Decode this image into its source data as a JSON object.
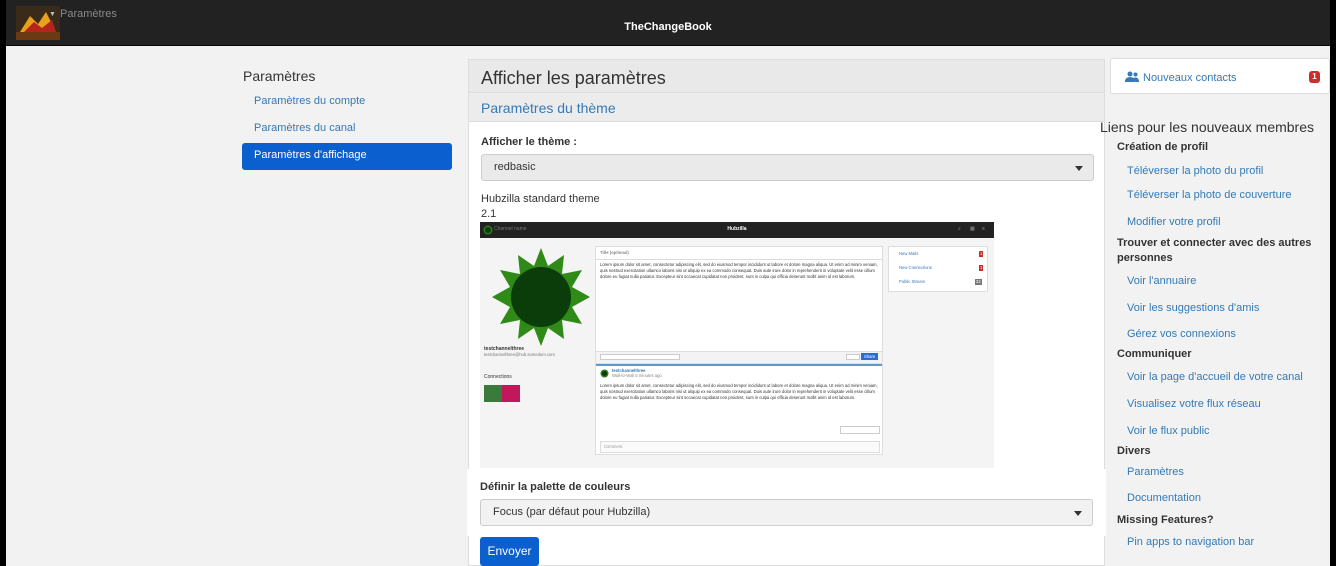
{
  "colors": {
    "accent": "#0b5fcf",
    "link": "#337ab7",
    "navbar": "#222222",
    "badge": "#c9302c"
  },
  "navbar": {
    "channel_label": "Paramètres",
    "app_title": "TheChangeBook"
  },
  "sidebar": {
    "title": "Paramètres",
    "items": [
      {
        "label": "Paramètres du compte",
        "active": false
      },
      {
        "label": "Paramètres du canal",
        "active": false
      },
      {
        "label": "Paramètres d'affichage",
        "active": true
      }
    ]
  },
  "main": {
    "title": "Afficher les paramètres",
    "section_title": "Paramètres du thème",
    "theme_label": "Afficher le thème :",
    "theme_value": "redbasic",
    "theme_name": "Hubzilla standard theme",
    "theme_version": "2.1",
    "palette_label": "Définir la palette de couleurs",
    "palette_value": "Focus (par défaut pour Hubzilla)",
    "submit_label": "Envoyer"
  },
  "preview": {
    "channel": "Channel name",
    "app": "Hubzilla",
    "title_placeholder": "Title (optional)",
    "lorem": "Lorem ipsum dolor sit amet, consectetur adipiscing elit, sed do eiusmod tempor incididunt ut labore et dolore magna aliqua. Ut enim ad minim veniam, quis nostrud exercitation ullamco laboris nisi ut aliquip ex ea commodo consequat. Duis aute irure dolor in reprehenderit in voluptate velit esse cillum dolore eu fugiat nulla pariatur. Excepteur sint occaecat cupidatat non proident, sunt in culpa qui officia deserunt mollit anim id est laborum.",
    "profile_name": "testchannelthree",
    "profile_address": "testchannelthree@hub.somedom.com",
    "connections_label": "Connections",
    "share": "Share",
    "post_author": "testchannelthree",
    "post_time": "Wall-to-Wall 5 minutes ago",
    "comment_placeholder": "Comment",
    "side_items": [
      {
        "label": "New Mails",
        "count": "1"
      },
      {
        "label": "New Connections",
        "count": "1"
      },
      {
        "label": "Public Stream",
        "count": "22"
      }
    ]
  },
  "right": {
    "contacts_label": "Nouveaux contacts",
    "contacts_count": "1",
    "title": "Liens pour les nouveaux membres",
    "groups": [
      {
        "heading": "Création de profil",
        "links": [
          "Téléverser la photo du profil",
          "Téléverser la photo de couverture",
          "Modifier votre profil"
        ]
      },
      {
        "heading": "Trouver et connecter avec des autres personnes",
        "links": [
          "Voir l'annuaire",
          "Voir les suggestions d'amis",
          "Gérez vos connexions"
        ]
      },
      {
        "heading": "Communiquer",
        "links": [
          "Voir la page d'accueil de votre canal",
          "Visualisez votre flux réseau",
          "Voir le flux public"
        ]
      },
      {
        "heading": "Divers",
        "links": [
          "Paramètres",
          "Documentation"
        ]
      },
      {
        "heading": "Missing Features?",
        "links": [
          "Pin apps to navigation bar"
        ]
      }
    ]
  }
}
